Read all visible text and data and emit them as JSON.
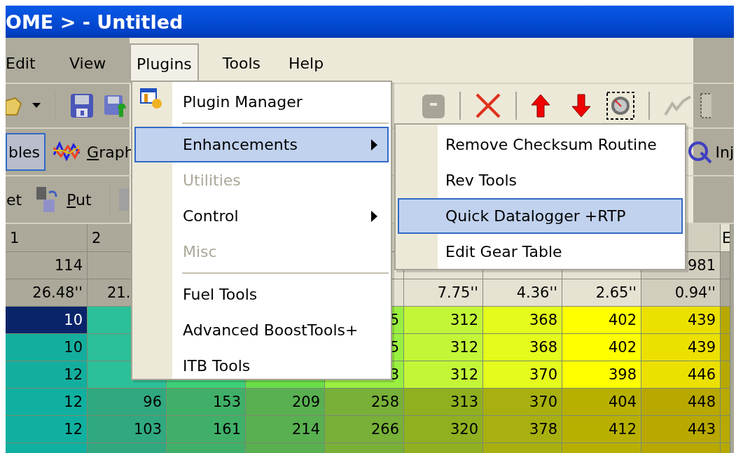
{
  "window": {
    "title": "OME > - Untitled"
  },
  "menu_bar": [
    {
      "label": "Edit",
      "selected": false
    },
    {
      "label": "View",
      "selected": false
    },
    {
      "label": "Plugins",
      "selected": true
    },
    {
      "label": "Tools",
      "selected": false
    },
    {
      "label": "Help",
      "selected": false
    }
  ],
  "view_toolbar": {
    "items": [
      {
        "label": "bles",
        "selected": true
      },
      {
        "label": "Graph",
        "selected": false
      }
    ],
    "right_label": "Inj"
  },
  "transfer_toolbar": {
    "items": [
      {
        "label": "et"
      },
      {
        "label": "Put"
      }
    ]
  },
  "table": {
    "header": {
      "col_1": "1",
      "col_2": "2",
      "col_10": "E"
    },
    "info_rows": [
      {
        "col_1": "114",
        "col_9": "981"
      },
      {
        "col_1": "26.48''",
        "col_2": "21.",
        "col_6": "7.75''",
        "col_7": "4.36''",
        "col_8": "2.65''",
        "col_9": "0.94''"
      }
    ],
    "rows": [
      {
        "col_1": {
          "text": "10",
          "selected": true
        },
        "col_5": {
          "text": "5",
          "selected": false
        },
        "col_6": {
          "text": "312",
          "selected": false
        },
        "col_7": {
          "text": "368",
          "selected": false
        },
        "col_8": {
          "text": "402",
          "selected": false
        },
        "col_9": {
          "text": "439",
          "selected": false
        }
      },
      {
        "col_1": {
          "text": "10",
          "selected": false
        },
        "col_5": {
          "text": "5",
          "selected": false
        },
        "col_6": {
          "text": "312",
          "selected": false
        },
        "col_7": {
          "text": "368",
          "selected": false
        },
        "col_8": {
          "text": "402",
          "selected": false
        },
        "col_9": {
          "text": "439",
          "selected": false
        }
      },
      {
        "col_1": {
          "text": "12",
          "selected": false
        },
        "col_5": {
          "text": "3",
          "selected": false
        },
        "col_6": {
          "text": "312",
          "selected": false
        },
        "col_7": {
          "text": "370",
          "selected": false
        },
        "col_8": {
          "text": "398",
          "selected": false
        },
        "col_9": {
          "text": "446",
          "selected": false
        }
      },
      {
        "col_1": {
          "text": "12",
          "selected": false
        },
        "col_2": {
          "text": "96",
          "selected": false
        },
        "col_3": {
          "text": "153",
          "selected": false
        },
        "col_4": {
          "text": "209",
          "selected": false
        },
        "col_5": {
          "text": "258",
          "selected": false
        },
        "col_6": {
          "text": "313",
          "selected": false
        },
        "col_7": {
          "text": "370",
          "selected": false
        },
        "col_8": {
          "text": "404",
          "selected": false
        },
        "col_9": {
          "text": "448",
          "selected": false
        }
      },
      {
        "col_1": {
          "text": "12",
          "selected": false
        },
        "col_2": {
          "text": "103",
          "selected": false
        },
        "col_3": {
          "text": "161",
          "selected": false
        },
        "col_4": {
          "text": "214",
          "selected": false
        },
        "col_5": {
          "text": "266",
          "selected": false
        },
        "col_6": {
          "text": "320",
          "selected": false
        },
        "col_7": {
          "text": "378",
          "selected": false
        },
        "col_8": {
          "text": "412",
          "selected": false
        },
        "col_9": {
          "text": "443",
          "selected": false
        }
      }
    ]
  },
  "plugins_menu": [
    {
      "kind": "command",
      "label": "Plugin Manager",
      "icon": true,
      "disabled": false,
      "selected": false
    },
    {
      "kind": "separator"
    },
    {
      "kind": "submenu",
      "label": "Enhancements",
      "disabled": false,
      "selected": true
    },
    {
      "kind": "command",
      "label": "Utilities",
      "disabled": true,
      "selected": false
    },
    {
      "kind": "submenu",
      "label": "Control",
      "disabled": false,
      "selected": false
    },
    {
      "kind": "command",
      "label": "Misc",
      "disabled": true,
      "selected": false
    },
    {
      "kind": "separator"
    },
    {
      "kind": "command",
      "label": "Fuel Tools",
      "disabled": false,
      "selected": false
    },
    {
      "kind": "command",
      "label": "Advanced BoostTools+",
      "disabled": false,
      "selected": false
    },
    {
      "kind": "command",
      "label": "ITB Tools",
      "disabled": false,
      "selected": false
    }
  ],
  "enhancements_submenu": [
    {
      "label": "Remove Checksum Routine",
      "selected": false
    },
    {
      "label": "Rev Tools",
      "selected": false
    },
    {
      "label": "Quick Datalogger +RTP",
      "selected": true
    },
    {
      "label": "Edit Gear Table",
      "selected": false
    }
  ]
}
